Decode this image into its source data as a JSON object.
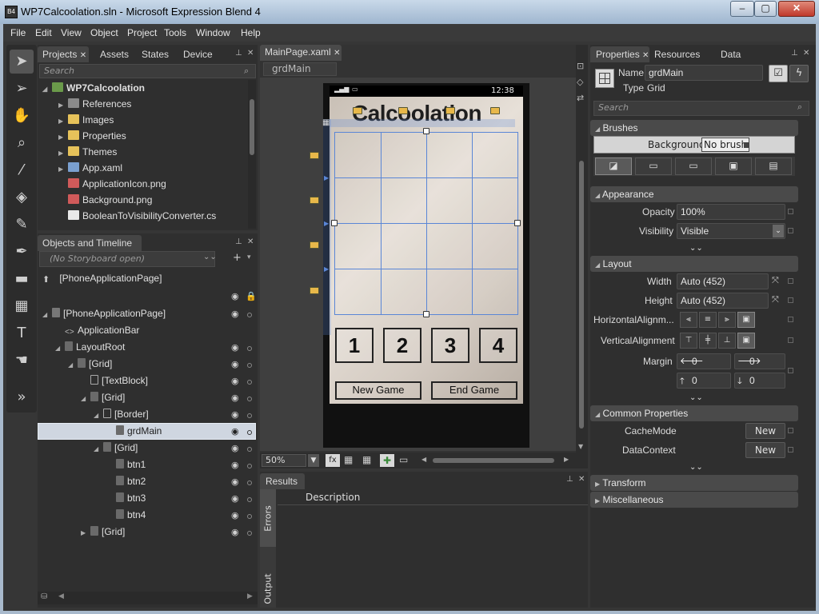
{
  "window": {
    "title": "WP7Calcoolation.sln - Microsoft Expression Blend 4",
    "app_icon": "blend-icon",
    "minimize": "▭",
    "maximize": "▢",
    "close": "✕"
  },
  "menu": [
    "File",
    "Edit",
    "View",
    "Object",
    "Project",
    "Tools",
    "Window",
    "Help"
  ],
  "tools": [
    "selection-icon",
    "direct-selection-icon",
    "pan-icon",
    "zoom-icon",
    "eyedropper-icon",
    "paint-bucket-icon",
    "gradient-icon",
    "pen-icon",
    "rectangle-icon",
    "grid-icon",
    "text-icon",
    "behavior-icon",
    "asset-library-icon"
  ],
  "projects_panel": {
    "tabs": [
      "Projects",
      "Assets",
      "States",
      "Device"
    ],
    "search_placeholder": "Search",
    "items": [
      {
        "label": "WP7Calcoolation",
        "type": "solution"
      },
      {
        "label": "References",
        "type": "references"
      },
      {
        "label": "Images",
        "type": "folder"
      },
      {
        "label": "Properties",
        "type": "folder"
      },
      {
        "label": "Themes",
        "type": "folder"
      },
      {
        "label": "App.xaml",
        "type": "xaml"
      },
      {
        "label": "ApplicationIcon.png",
        "type": "png"
      },
      {
        "label": "Background.png",
        "type": "png"
      },
      {
        "label": "BooleanToVisibilityConverter.cs",
        "type": "cs"
      }
    ]
  },
  "objects_panel": {
    "title": "Objects and Timeline",
    "storyboard": "(No Storyboard open)",
    "root_scope": "[PhoneApplicationPage]",
    "items": [
      {
        "label": "[PhoneApplicationPage]",
        "depth": 0
      },
      {
        "label": "ApplicationBar",
        "depth": 1
      },
      {
        "label": "LayoutRoot",
        "depth": 1
      },
      {
        "label": "[Grid]",
        "depth": 2
      },
      {
        "label": "[TextBlock]",
        "depth": 3
      },
      {
        "label": "[Grid]",
        "depth": 3
      },
      {
        "label": "[Border]",
        "depth": 4
      },
      {
        "label": "grdMain",
        "depth": 5
      },
      {
        "label": "[Grid]",
        "depth": 4
      },
      {
        "label": "btn1",
        "depth": 5
      },
      {
        "label": "btn2",
        "depth": 5
      },
      {
        "label": "btn3",
        "depth": 5
      },
      {
        "label": "btn4",
        "depth": 5
      },
      {
        "label": "[Grid]",
        "depth": 3
      }
    ]
  },
  "document": {
    "tab": "MainPage.xaml",
    "breadcrumb": "grdMain",
    "zoom": "50%",
    "phone": {
      "time": "12:38",
      "title": "Calcoolation",
      "buttons": [
        "1",
        "2",
        "3",
        "4"
      ],
      "new_game": "New Game",
      "end_game": "End Game"
    }
  },
  "results": {
    "title": "Results",
    "column": "Description",
    "side_tabs": [
      "Errors",
      "Output"
    ]
  },
  "properties": {
    "tabs": [
      "Properties",
      "Resources",
      "Data"
    ],
    "name_label": "Name",
    "name_value": "grdMain",
    "type_label": "Type",
    "type_value": "Grid",
    "search_placeholder": "Search",
    "brushes": {
      "title": "Brushes",
      "background_label": "Background",
      "background_value": "No brush"
    },
    "appearance": {
      "title": "Appearance",
      "opacity_label": "Opacity",
      "opacity_value": "100%",
      "visibility_label": "Visibility",
      "visibility_value": "Visible"
    },
    "layout": {
      "title": "Layout",
      "width_label": "Width",
      "width_value": "Auto (452)",
      "height_label": "Height",
      "height_value": "Auto (452)",
      "halign_label": "HorizontalAlignm...",
      "valign_label": "VerticalAlignment",
      "margin_label": "Margin",
      "margin_left": "0",
      "margin_right": "0",
      "margin_top": "0",
      "margin_bottom": "0"
    },
    "common": {
      "title": "Common Properties",
      "cachemode_label": "CacheMode",
      "cachemode_btn": "New",
      "datacontext_label": "DataContext",
      "datacontext_btn": "New"
    },
    "transform": {
      "title": "Transform"
    },
    "misc": {
      "title": "Miscellaneous"
    }
  }
}
